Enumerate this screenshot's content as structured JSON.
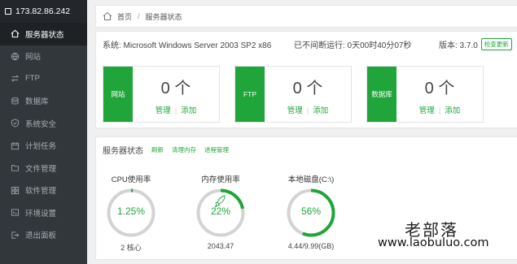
{
  "sidebar": {
    "ip": "173.82.86.242",
    "items": [
      {
        "label": "服务器状态",
        "icon": "home-icon",
        "active": true
      },
      {
        "label": "网站",
        "icon": "globe-icon"
      },
      {
        "label": "FTP",
        "icon": "transfer-icon"
      },
      {
        "label": "数据库",
        "icon": "database-icon"
      },
      {
        "label": "系统安全",
        "icon": "shield-icon"
      },
      {
        "label": "计划任务",
        "icon": "calendar-icon"
      },
      {
        "label": "文件管理",
        "icon": "folder-icon"
      },
      {
        "label": "软件管理",
        "icon": "apps-icon"
      },
      {
        "label": "环境设置",
        "icon": "settings-icon"
      },
      {
        "label": "退出面板",
        "icon": "logout-icon"
      }
    ]
  },
  "breadcrumb": {
    "home": "首页",
    "current": "服务器状态"
  },
  "system": {
    "os": "系统: Microsoft Windows Server 2003 SP2 x86",
    "uptime": "已不间断运行: 0天00时40分07秒",
    "version": "版本: 3.7.0",
    "check_update": "检查更新"
  },
  "cards": [
    {
      "tag": "网站",
      "count": "0 个",
      "manage": "管理",
      "add": "添加"
    },
    {
      "tag": "FTP",
      "count": "0 个",
      "manage": "管理",
      "add": "添加"
    },
    {
      "tag": "数据库",
      "count": "0 个",
      "manage": "管理",
      "add": "添加"
    }
  ],
  "status": {
    "title": "服务器状态",
    "refresh": "刷新",
    "clear_mem": "清理内存",
    "process": "进程管理",
    "accent": "#20a53a",
    "gauges": [
      {
        "label": "CPU使用率",
        "value": "1.25%",
        "percent": 1.25,
        "sub": "2 核心"
      },
      {
        "label": "内存使用率",
        "value": "22%",
        "percent": 22,
        "sub": "2043.47"
      },
      {
        "label": "本地磁盘(C:\\)",
        "value": "56%",
        "percent": 56,
        "sub": "4.44/9.99(GB)"
      }
    ]
  },
  "watermark": {
    "cn": "老部落",
    "url": "www.laobuluo.com"
  }
}
